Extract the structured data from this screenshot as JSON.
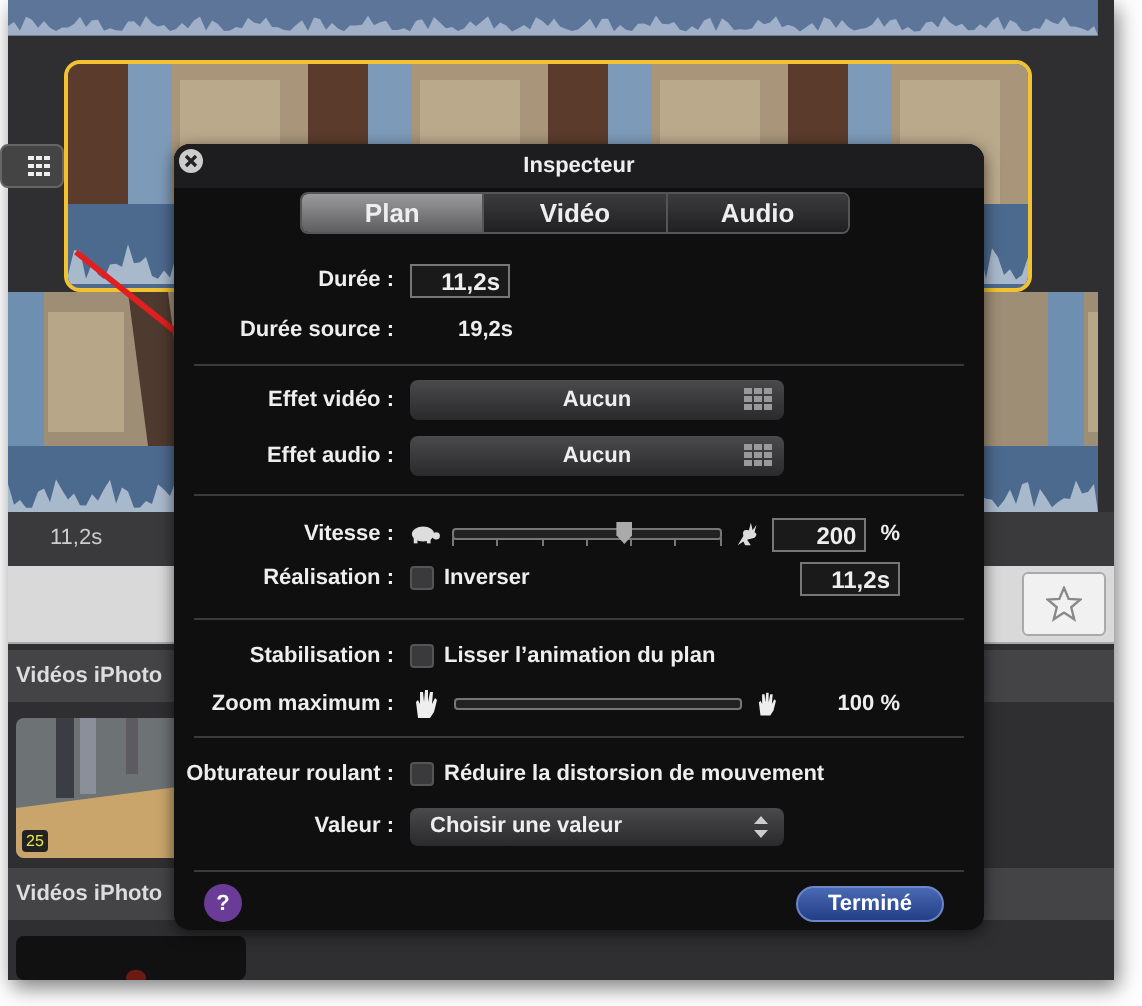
{
  "timeline": {
    "status": "11,2s"
  },
  "browser": {
    "sections": [
      {
        "title": "Vidéos iPhoto",
        "badge": "25"
      },
      {
        "title": "Vidéos iPhoto"
      }
    ]
  },
  "inspector": {
    "title": "Inspecteur",
    "tabs": [
      {
        "label": "Plan",
        "selected": true
      },
      {
        "label": "Vidéo",
        "selected": false
      },
      {
        "label": "Audio",
        "selected": false
      }
    ],
    "duration": {
      "label": "Durée :",
      "value": "11,2s"
    },
    "source_duration": {
      "label": "Durée source :",
      "value": "19,2s"
    },
    "effects": [
      {
        "label": "Effet vidéo :",
        "value": "Aucun"
      },
      {
        "label": "Effet audio :",
        "value": "Aucun"
      }
    ],
    "speed": {
      "label": "Vitesse :",
      "level": 0.64,
      "value": "200",
      "unit": "%"
    },
    "direction": {
      "label": "Réalisation :",
      "checkbox": "Inverser",
      "checked": false,
      "value": "11,2s"
    },
    "stabilization": {
      "label": "Stabilisation :",
      "checkbox": "Lisser l’animation du plan",
      "checked": false
    },
    "zoom": {
      "label": "Zoom maximum :",
      "level": 0,
      "value": "100 %"
    },
    "rolling_shutter": {
      "label": "Obturateur roulant :",
      "checkbox": "Réduire la distorsion de mouvement",
      "checked": false
    },
    "amount": {
      "label": "Valeur :",
      "value": "Choisir une valeur"
    },
    "help": "?",
    "done": "Terminé"
  }
}
